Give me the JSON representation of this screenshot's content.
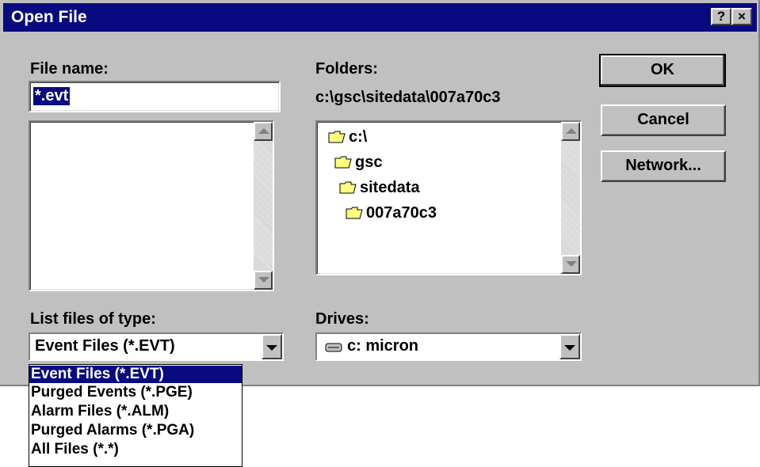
{
  "window": {
    "title": "Open File"
  },
  "titlebar_buttons": {
    "help": "?",
    "close": "×"
  },
  "file_name": {
    "label": "File name:",
    "value": "*.evt"
  },
  "folders": {
    "label": "Folders:",
    "path": "c:\\gsc\\sitedata\\007a70c3",
    "items": [
      "c:\\",
      "gsc",
      "sitedata",
      "007a70c3"
    ]
  },
  "buttons": {
    "ok": "OK",
    "cancel": "Cancel",
    "network": "Network..."
  },
  "list_type": {
    "label": "List files of type:",
    "selected": "Event Files (*.EVT)",
    "options": [
      "Event Files (*.EVT)",
      "Purged Events (*.PGE)",
      "Alarm Files (*.ALM)",
      "Purged Alarms (*.PGA)",
      "All Files (*.*)"
    ]
  },
  "drives": {
    "label": "Drives:",
    "selected": "c: micron"
  },
  "colors": {
    "titlebar": "#0a0a80",
    "face": "#c0c0c0",
    "highlight": "#0a0a80"
  }
}
